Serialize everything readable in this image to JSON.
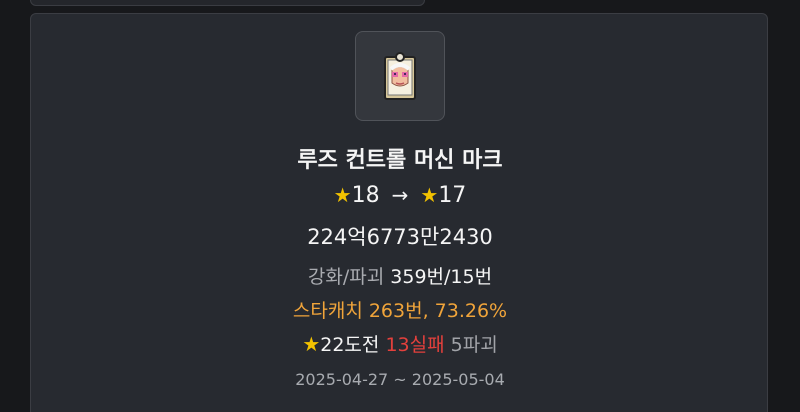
{
  "item": {
    "name": "루즈 컨트롤 머신 마크",
    "icon": "face-accessory-icon"
  },
  "enhance": {
    "from_star": "★",
    "from_level": "18",
    "arrow": "→",
    "to_star": "★",
    "to_level": "17"
  },
  "cost": "224억6773만2430",
  "ratio": {
    "label": "강화/파괴",
    "value": "359번/15번"
  },
  "starcatch": "스타캐치 263번, 73.26%",
  "challenge": {
    "star": "★",
    "attempt": "22도전",
    "fail": "13실패",
    "destroy": "5파괴"
  },
  "date_range": "2025-04-27 ~ 2025-05-04",
  "colors": {
    "background": "#17181b",
    "card": "#272a30",
    "star": "#f2c200",
    "starcatch": "#f0a43a",
    "fail": "#e3403c",
    "muted": "#a8abb0"
  }
}
